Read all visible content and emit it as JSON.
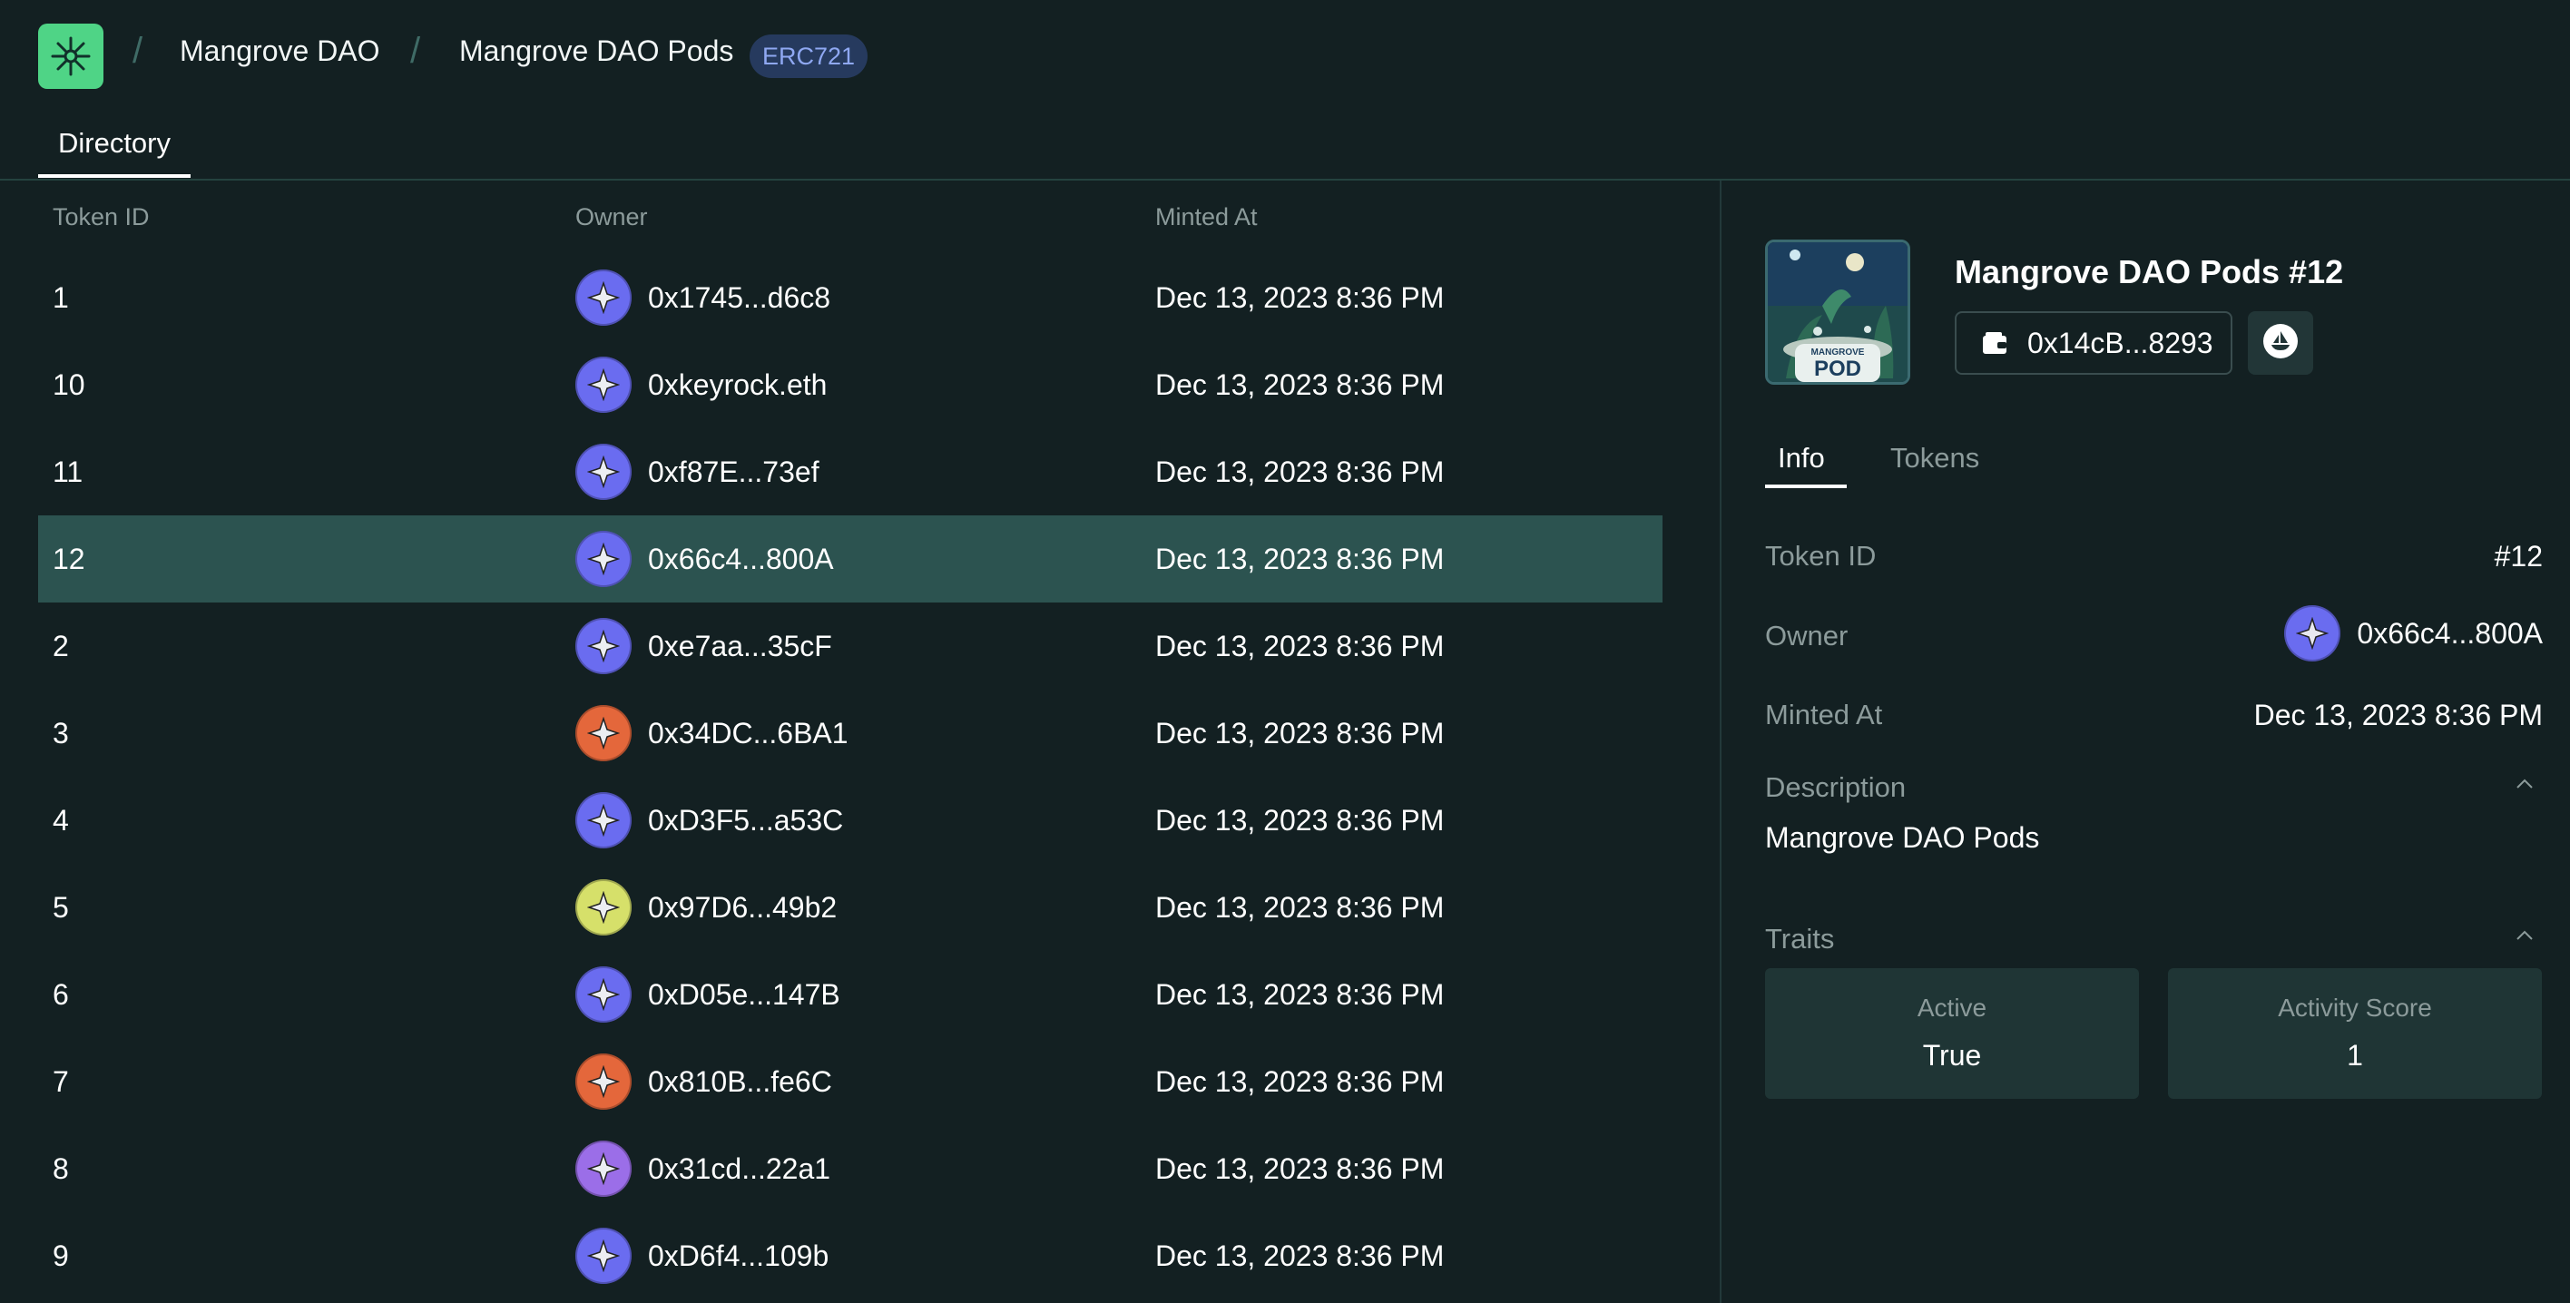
{
  "header": {
    "breadcrumb_1": "Mangrove DAO",
    "breadcrumb_2": "Mangrove DAO Pods",
    "badge": "ERC721",
    "separator": "/"
  },
  "tabs": {
    "directory": "Directory"
  },
  "table": {
    "columns": [
      "Token ID",
      "Owner",
      "Minted At"
    ],
    "rows": [
      {
        "token_id": "1",
        "owner": "0x1745...d6c8",
        "minted": "Dec 13, 2023 8:36 PM",
        "avatar_color": "#6a6cf0"
      },
      {
        "token_id": "10",
        "owner": "0xkeyrock.eth",
        "minted": "Dec 13, 2023 8:36 PM",
        "avatar_color": "#6a6cf0"
      },
      {
        "token_id": "11",
        "owner": "0xf87E...73ef",
        "minted": "Dec 13, 2023 8:36 PM",
        "avatar_color": "#6a6cf0"
      },
      {
        "token_id": "12",
        "owner": "0x66c4...800A",
        "minted": "Dec 13, 2023 8:36 PM",
        "avatar_color": "#6a6cf0",
        "selected": true
      },
      {
        "token_id": "2",
        "owner": "0xe7aa...35cF",
        "minted": "Dec 13, 2023 8:36 PM",
        "avatar_color": "#6a6cf0"
      },
      {
        "token_id": "3",
        "owner": "0x34DC...6BA1",
        "minted": "Dec 13, 2023 8:36 PM",
        "avatar_color": "#e4673b"
      },
      {
        "token_id": "4",
        "owner": "0xD3F5...a53C",
        "minted": "Dec 13, 2023 8:36 PM",
        "avatar_color": "#6a6cf0"
      },
      {
        "token_id": "5",
        "owner": "0x97D6...49b2",
        "minted": "Dec 13, 2023 8:36 PM",
        "avatar_color": "#d6e06a"
      },
      {
        "token_id": "6",
        "owner": "0xD05e...147B",
        "minted": "Dec 13, 2023 8:36 PM",
        "avatar_color": "#6a6cf0"
      },
      {
        "token_id": "7",
        "owner": "0x810B...fe6C",
        "minted": "Dec 13, 2023 8:36 PM",
        "avatar_color": "#e4673b"
      },
      {
        "token_id": "8",
        "owner": "0x31cd...22a1",
        "minted": "Dec 13, 2023 8:36 PM",
        "avatar_color": "#9b6ee8"
      },
      {
        "token_id": "9",
        "owner": "0xD6f4...109b",
        "minted": "Dec 13, 2023 8:36 PM",
        "avatar_color": "#6a6cf0"
      }
    ]
  },
  "panel": {
    "title": "Mangrove DAO Pods #12",
    "contract_address": "0x14cB...8293",
    "thumbnail_small_text": "MANGROVE",
    "thumbnail_big_text": "POD",
    "tabs": [
      "Info",
      "Tokens"
    ],
    "token_id_label": "Token ID",
    "token_id_value": "#12",
    "owner_label": "Owner",
    "owner_value": "0x66c4...800A",
    "minted_label": "Minted At",
    "minted_value": "Dec 13, 2023 8:36 PM",
    "description_label": "Description",
    "description_value": "Mangrove DAO Pods",
    "traits_label": "Traits",
    "traits": [
      {
        "name": "Active",
        "value": "True"
      },
      {
        "name": "Activity Score",
        "value": "1"
      }
    ]
  },
  "colors": {
    "background": "#132022",
    "selected_row": "#2c5350",
    "logo": "#4fd486",
    "badge_bg": "#263a5e",
    "badge_text": "#8fa8f2"
  },
  "icons": [
    "flower-logo-icon",
    "wallet-icon",
    "opensea-icon",
    "chevron-up-icon",
    "star-avatar-icon"
  ]
}
